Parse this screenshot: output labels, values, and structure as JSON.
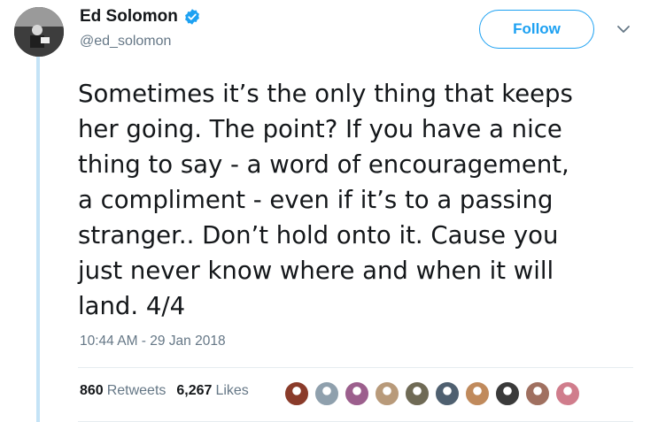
{
  "user": {
    "display_name": "Ed Solomon",
    "handle": "@ed_solomon",
    "verified": true,
    "avatar_icon": "user-avatar"
  },
  "actions": {
    "follow_label": "Follow",
    "caret_icon": "chevron-down-icon"
  },
  "tweet": {
    "text": "Sometimes it’s the only thing that keeps\nher going. The point? If you have a nice\nthing to say - a word of encouragement,\na compliment - even if it’s to a passing\nstranger.. Don’t hold onto it. Cause you\njust never know where and when it will\nland. 4/4",
    "timestamp": "10:44 AM - 29 Jan 2018"
  },
  "stats": {
    "retweets_count": "860",
    "retweets_label": "Retweets",
    "likes_count": "6,267",
    "likes_label": "Likes"
  },
  "likers": [
    {
      "name": "liker-avatar-1",
      "color": "#8a3b2a"
    },
    {
      "name": "liker-avatar-2",
      "color": "#8fa0ad"
    },
    {
      "name": "liker-avatar-3",
      "color": "#9c5f8d"
    },
    {
      "name": "liker-avatar-4",
      "color": "#b89a7a"
    },
    {
      "name": "liker-avatar-5",
      "color": "#6f6a55"
    },
    {
      "name": "liker-avatar-6",
      "color": "#4f6070"
    },
    {
      "name": "liker-avatar-7",
      "color": "#c08a5c"
    },
    {
      "name": "liker-avatar-8",
      "color": "#3a3a3a"
    },
    {
      "name": "liker-avatar-9",
      "color": "#a07060"
    },
    {
      "name": "liker-avatar-10",
      "color": "#d07d8c"
    }
  ],
  "colors": {
    "accent": "#1da1f2",
    "thread_line": "#c4e3f6",
    "secondary_text": "#657786"
  }
}
